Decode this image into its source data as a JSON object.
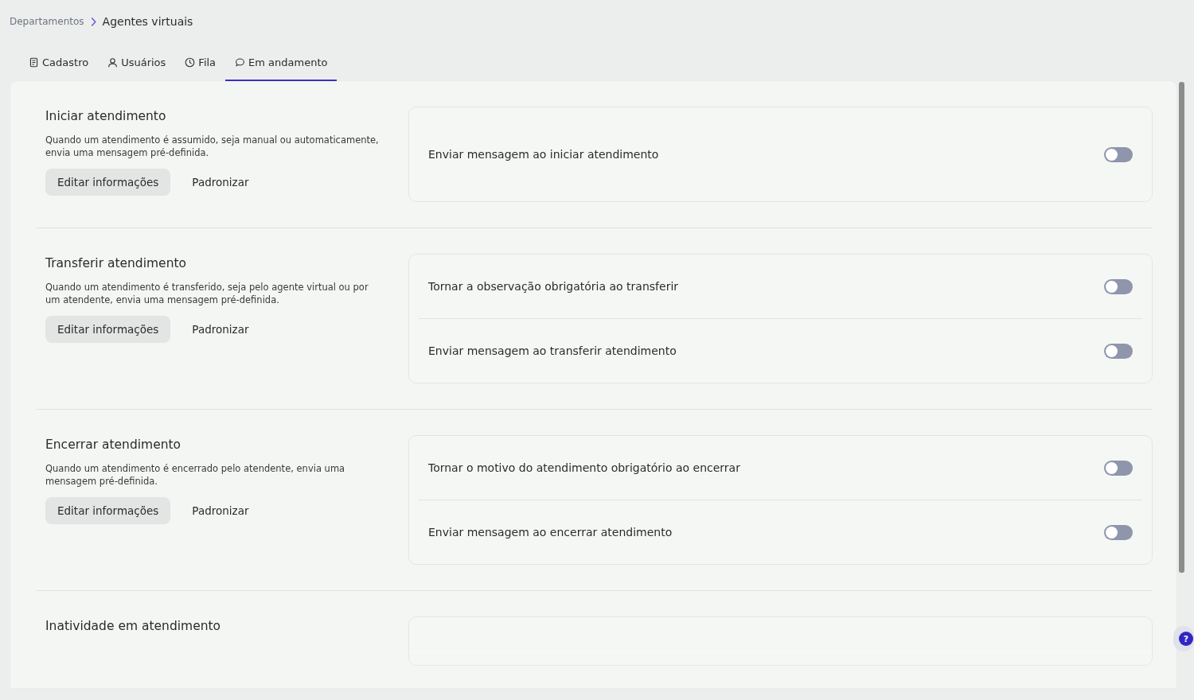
{
  "breadcrumb": [
    {
      "label": "Departamentos",
      "current": false
    },
    {
      "label": "Agentes virtuais",
      "current": true
    }
  ],
  "tabs": [
    {
      "label": "Cadastro",
      "kind": "document",
      "selected": false
    },
    {
      "label": "Usuários",
      "kind": "user",
      "selected": false
    },
    {
      "label": "Fila",
      "kind": "clock",
      "selected": false
    },
    {
      "label": "Em andamento",
      "kind": "chat",
      "selected": true
    }
  ],
  "sections": [
    {
      "title": "Iniciar atendimento",
      "description": "Quando um atendimento é assumido, seja manual ou automaticamente, envia uma mensagem pré-definida.",
      "buttons": [
        "Editar informações",
        "Padronizar"
      ],
      "settings": [
        {
          "label": "Enviar mensagem ao iniciar atendimento",
          "on": false
        }
      ]
    },
    {
      "title": "Transferir atendimento",
      "description": "Quando um atendimento é transferido, seja pelo agente virtual ou por um atendente, envia uma mensagem pré-definida.",
      "buttons": [
        "Editar informações",
        "Padronizar"
      ],
      "settings": [
        {
          "label": "Tornar a observação obrigatória ao transferir",
          "on": false
        },
        {
          "label": "Enviar mensagem ao transferir atendimento",
          "on": false
        }
      ]
    },
    {
      "title": "Encerrar atendimento",
      "description": "Quando um atendimento é encerrado pelo atendente, envia uma mensagem pré-definida.",
      "buttons": [
        "Editar informações",
        "Padronizar"
      ],
      "settings": [
        {
          "label": "Tornar o motivo do atendimento obrigatório ao encerrar",
          "on": false
        },
        {
          "label": "Enviar mensagem ao encerrar atendimento",
          "on": false
        }
      ]
    },
    {
      "title": "Inatividade em atendimento"
    }
  ],
  "help": {
    "label": "?"
  }
}
